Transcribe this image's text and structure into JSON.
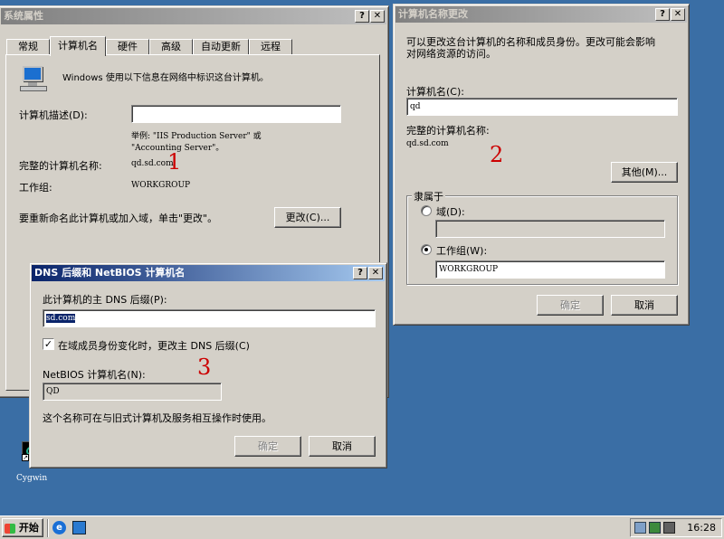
{
  "sys_props": {
    "title": "系统属性",
    "tabs": [
      "常规",
      "计算机名",
      "硬件",
      "高级",
      "自动更新",
      "远程"
    ],
    "intro": "Windows 使用以下信息在网络中标识这台计算机。",
    "desc_label": "计算机描述(D):",
    "desc_value": "",
    "example_line1": "举例: \"IIS Production Server\" 或",
    "example_line2": "\"Accounting Server\"。",
    "full_name_label": "完整的计算机名称:",
    "full_name_value": "qd.sd.com",
    "workgroup_label": "工作组:",
    "workgroup_value": "WORKGROUP",
    "rename_text": "要重新命名此计算机或加入域，单击\"更改\"。",
    "change_button": "更改(C)...",
    "annotation": "1"
  },
  "name_change": {
    "title": "计算机名称更改",
    "intro_line1": "可以更改这台计算机的名称和成员身份。更改可能会影响",
    "intro_line2": "对网络资源的访问。",
    "computer_name_label": "计算机名(C):",
    "computer_name_value": "qd",
    "full_name_label": "完整的计算机名称:",
    "full_name_value": "qd.sd.com",
    "other_button": "其他(M)...",
    "member_of_label": "隶属于",
    "domain_label": "域(D):",
    "domain_value": "",
    "workgroup_label": "工作组(W):",
    "workgroup_value": "WORKGROUP",
    "membership": "workgroup",
    "ok_button": "确定",
    "cancel_button": "取消",
    "annotation": "2"
  },
  "dns_dialog": {
    "title": "DNS 后缀和 NetBIOS 计算机名",
    "primary_suffix_label": "此计算机的主 DNS 后缀(P):",
    "primary_suffix_value": "sd.com",
    "checkbox_label": "在域成员身份变化时，更改主 DNS 后缀(C)",
    "checkbox_checked": true,
    "netbios_label": "NetBIOS 计算机名(N):",
    "netbios_value": "QD",
    "note": "这个名称可在与旧式计算机及服务相互操作时使用。",
    "ok_button": "确定",
    "cancel_button": "取消",
    "annotation": "3"
  },
  "title_buttons": {
    "help": "?",
    "close": "✕"
  },
  "desktop": {
    "cygwin_label": "Cygwin"
  },
  "taskbar": {
    "start_label": "开始",
    "clock": "16:28"
  },
  "colors": {
    "desktop": "#3a6ea5",
    "window_face": "#d4d0c8",
    "title_active": "#0a246a",
    "annotation": "#cc0000"
  }
}
